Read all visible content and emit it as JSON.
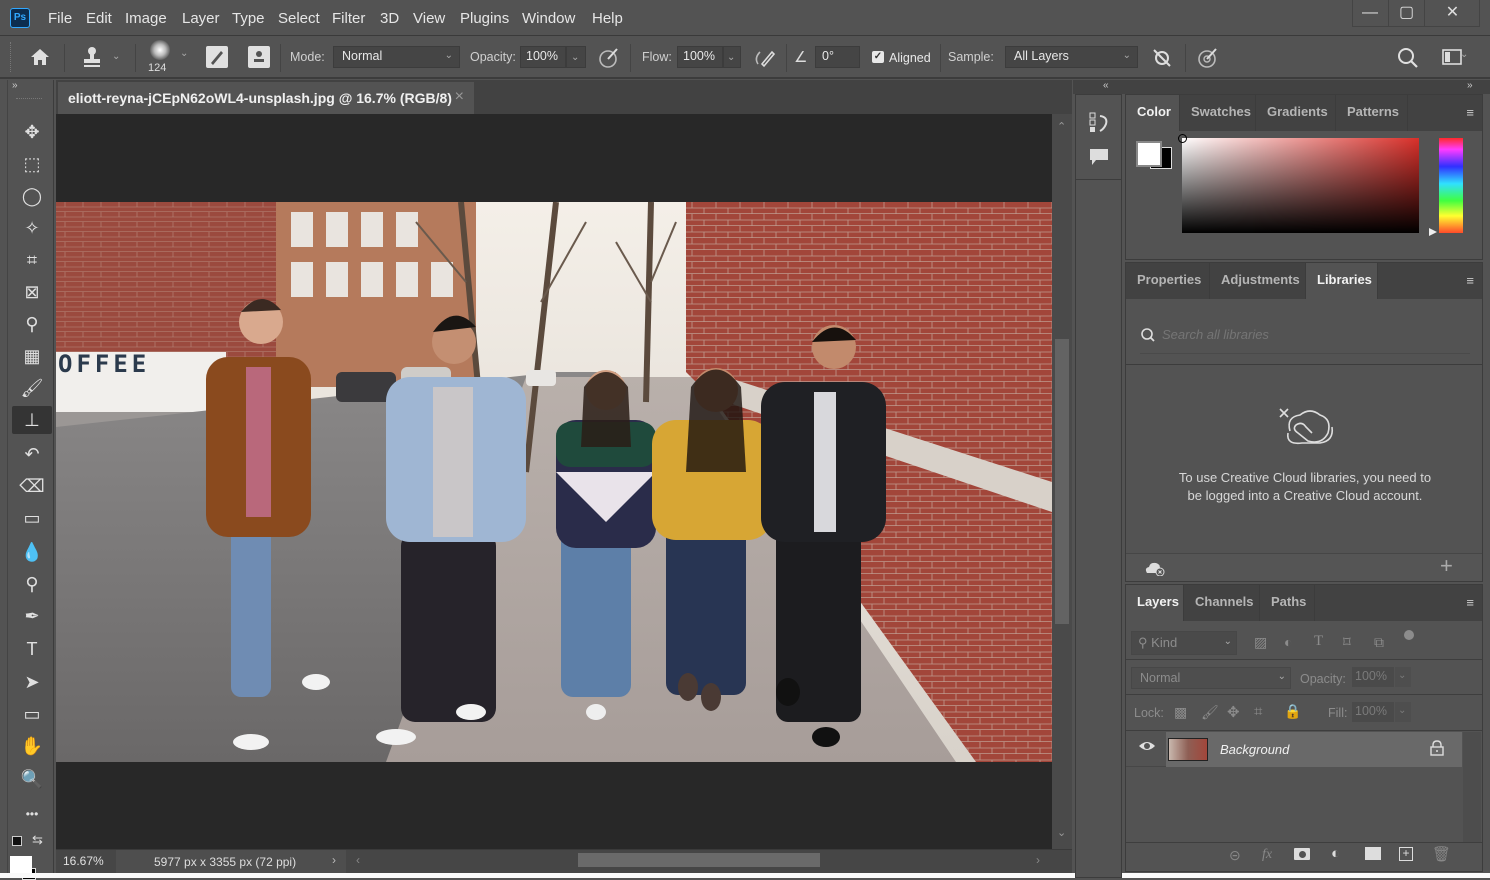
{
  "app": {
    "logo": "Ps",
    "window_controls": {
      "minimize": "—",
      "maximize": "▢",
      "close": "✕"
    }
  },
  "menu": [
    "File",
    "Edit",
    "Image",
    "Layer",
    "Type",
    "Select",
    "Filter",
    "3D",
    "View",
    "Plugins",
    "Window",
    "Help"
  ],
  "options_bar": {
    "brush_size": "124",
    "mode_label": "Mode:",
    "mode_value": "Normal",
    "opacity_label": "Opacity:",
    "opacity_value": "100%",
    "flow_label": "Flow:",
    "flow_value": "100%",
    "angle_value": "0°",
    "aligned_label": "Aligned",
    "aligned_checked": true,
    "sample_label": "Sample:",
    "sample_value": "All Layers"
  },
  "document": {
    "tab_title": "eliott-reyna-jCEpN62oWL4-unsplash.jpg @ 16.7% (RGB/8)",
    "close_glyph": "×",
    "photo_sign_text": "OFFEE"
  },
  "status": {
    "zoom": "16.67%",
    "doc_info": "5977 px x 3355 px (72 ppi)"
  },
  "tools": [
    {
      "name": "move-tool",
      "glyph": "✥"
    },
    {
      "name": "marquee-tool",
      "glyph": "⬚"
    },
    {
      "name": "lasso-tool",
      "glyph": "◯"
    },
    {
      "name": "magic-wand-tool",
      "glyph": "✧"
    },
    {
      "name": "crop-tool",
      "glyph": "⌗"
    },
    {
      "name": "frame-tool",
      "glyph": "⊠"
    },
    {
      "name": "eyedropper-tool",
      "glyph": "⚲"
    },
    {
      "name": "healing-brush-tool",
      "glyph": "▦"
    },
    {
      "name": "brush-tool",
      "glyph": "🖌"
    },
    {
      "name": "clone-stamp-tool",
      "glyph": "⊥"
    },
    {
      "name": "history-brush-tool",
      "glyph": "↶"
    },
    {
      "name": "eraser-tool",
      "glyph": "⌫"
    },
    {
      "name": "gradient-tool",
      "glyph": "▭"
    },
    {
      "name": "blur-tool",
      "glyph": "💧"
    },
    {
      "name": "dodge-tool",
      "glyph": "⚲"
    },
    {
      "name": "pen-tool",
      "glyph": "✒"
    },
    {
      "name": "type-tool",
      "glyph": "T"
    },
    {
      "name": "path-selection-tool",
      "glyph": "➤"
    },
    {
      "name": "rectangle-tool",
      "glyph": "▭"
    },
    {
      "name": "hand-tool",
      "glyph": "✋"
    },
    {
      "name": "zoom-tool",
      "glyph": "🔍"
    },
    {
      "name": "edit-toolbar",
      "glyph": "•••"
    }
  ],
  "color_panel": {
    "tabs": [
      "Color",
      "Swatches",
      "Gradients",
      "Patterns"
    ],
    "active_tab": "Color",
    "foreground": "#ffffff",
    "background": "#000000",
    "hue_color": "#d9302a"
  },
  "libraries_panel": {
    "tabs": [
      "Properties",
      "Adjustments",
      "Libraries"
    ],
    "active_tab": "Libraries",
    "search_placeholder": "Search all libraries",
    "message": "To use Creative Cloud libraries, you need to be logged into a Creative Cloud account."
  },
  "layers_panel": {
    "tabs": [
      "Layers",
      "Channels",
      "Paths"
    ],
    "active_tab": "Layers",
    "filter_kind": "Kind",
    "blend_mode": "Normal",
    "opacity_label": "Opacity:",
    "opacity_value": "100%",
    "lock_label": "Lock:",
    "fill_label": "Fill:",
    "fill_value": "100%",
    "layers": [
      {
        "name": "Background",
        "visible": true,
        "locked": true
      }
    ]
  }
}
